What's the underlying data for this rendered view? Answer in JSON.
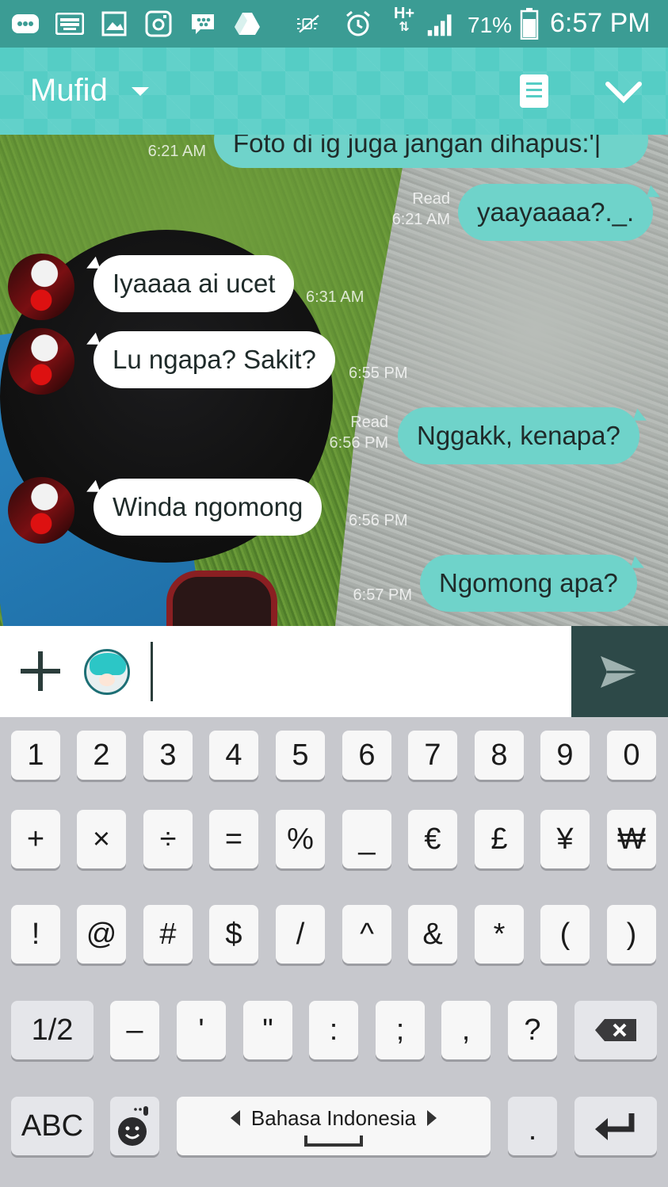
{
  "status_bar": {
    "icons": [
      "message-icon",
      "keyboard-icon",
      "image-icon",
      "instagram-icon",
      "bbm-icon",
      "drive-icon",
      "mute-icon",
      "alarm-icon",
      "hplus-data-icon",
      "signal-icon",
      "battery-icon"
    ],
    "network": "H+",
    "battery": "71%",
    "time": "6:57 PM"
  },
  "header": {
    "title": "Mufid",
    "icons": [
      "dropdown-caret-icon",
      "notes-icon",
      "chevron-down-icon"
    ],
    "accent": "#55cdc5"
  },
  "messages": [
    {
      "direction": "out",
      "text": "Foto di ig juga jangan dihapus:'|",
      "time": "6:21 AM",
      "status": ""
    },
    {
      "direction": "out",
      "text": "yaayaaaa?._.",
      "time": "6:21 AM",
      "status": "Read"
    },
    {
      "direction": "in",
      "text": "Iyaaaa ai ucet",
      "time": "6:31 AM"
    },
    {
      "direction": "in",
      "text": "Lu ngapa? Sakit?",
      "time": "6:55 PM"
    },
    {
      "direction": "out",
      "text": "Nggakk, kenapa?",
      "time": "6:56 PM",
      "status": "Read"
    },
    {
      "direction": "in",
      "text": "Winda ngomong",
      "time": "6:56 PM"
    },
    {
      "direction": "out",
      "text": "Ngomong apa?",
      "time": "6:57 PM",
      "status": ""
    }
  ],
  "input": {
    "value": "",
    "placeholder": "",
    "icons": [
      "plus-icon",
      "sticker-icon",
      "send-icon"
    ],
    "send_color": "#2d4948"
  },
  "keyboard": {
    "row1": [
      "1",
      "2",
      "3",
      "4",
      "5",
      "6",
      "7",
      "8",
      "9",
      "0"
    ],
    "row2": [
      "+",
      "×",
      "÷",
      "=",
      "%",
      "_",
      "€",
      "£",
      "¥",
      "₩"
    ],
    "row3": [
      "!",
      "@",
      "#",
      "$",
      "/",
      "^",
      "&",
      "*",
      "(",
      ")"
    ],
    "row4": [
      "1/2",
      "–",
      "'",
      "\"",
      ":",
      ";",
      ",",
      "?"
    ],
    "row5": {
      "abc": "ABC",
      "space_language": "Bahasa Indonesia",
      "period": "."
    },
    "icons": [
      "backspace-icon",
      "emoji-mic-icon",
      "left-arrow-icon",
      "right-arrow-icon",
      "enter-icon"
    ]
  }
}
